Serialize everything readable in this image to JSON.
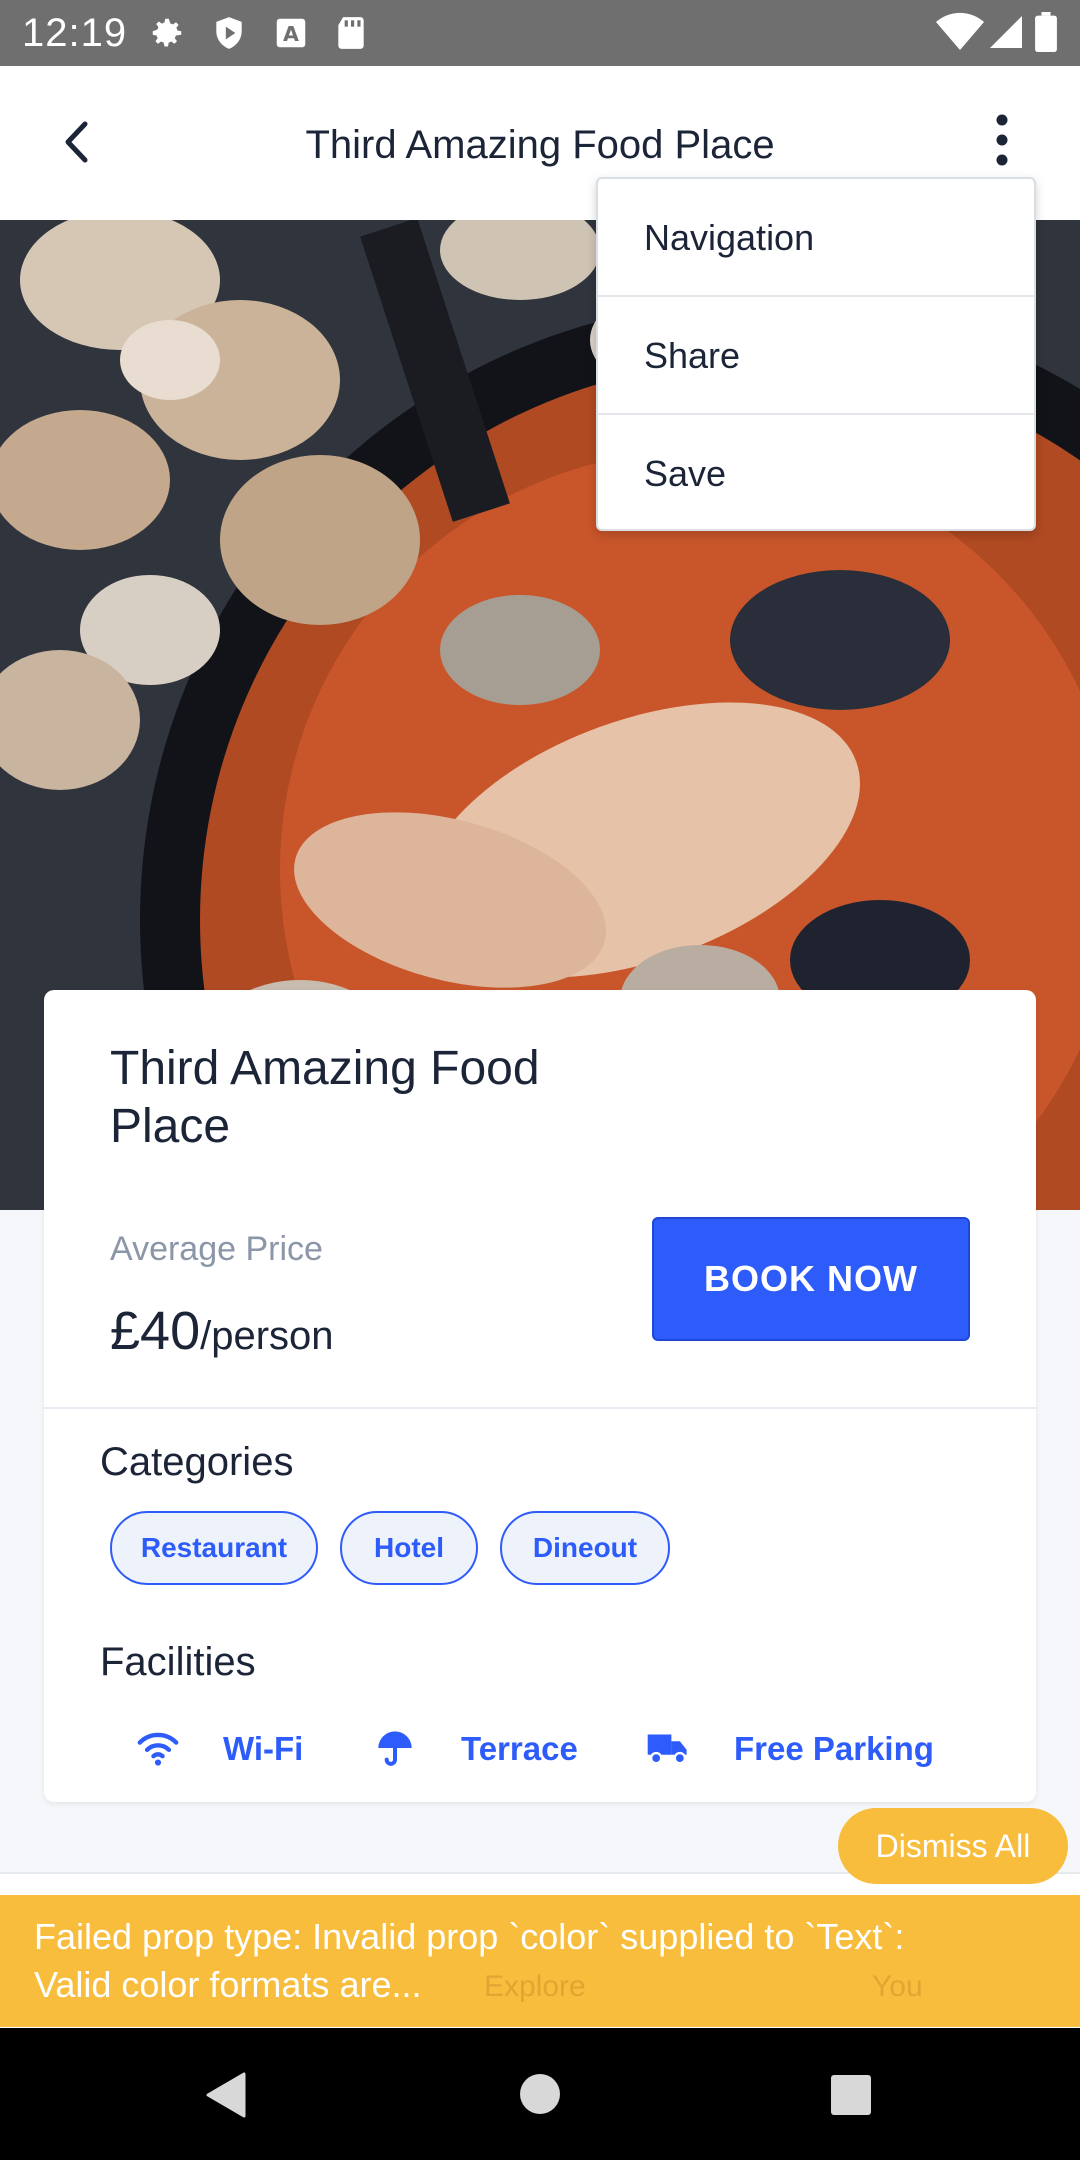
{
  "status_bar": {
    "time": "12:19",
    "icons": [
      "gear-icon",
      "shield-icon",
      "font-a-icon",
      "sd-card-icon",
      "wifi-icon",
      "signal-icon",
      "battery-icon"
    ]
  },
  "app_bar": {
    "title": "Third Amazing Food Place",
    "back_icon": "chevron-left-icon",
    "more_icon": "more-vertical-icon"
  },
  "menu": {
    "items": [
      {
        "label": "Navigation"
      },
      {
        "label": "Share"
      },
      {
        "label": "Save"
      }
    ]
  },
  "place": {
    "title": "Third Amazing Food Place",
    "avg_price_label": "Average Price",
    "price_amount": "£40",
    "price_unit": "/person",
    "book_label": "BOOK NOW"
  },
  "categories": {
    "title": "Categories",
    "items": [
      "Restaurant",
      "Hotel",
      "Dineout"
    ]
  },
  "facilities": {
    "title": "Facilities",
    "items": [
      {
        "label": "Wi-Fi",
        "icon": "wifi-icon"
      },
      {
        "label": "Terrace",
        "icon": "umbrella-icon"
      },
      {
        "label": "Free Parking",
        "icon": "truck-icon"
      }
    ]
  },
  "tab_bar": {
    "tabs": [
      "Explore",
      "You"
    ]
  },
  "toast": {
    "dismiss_label": "Dismiss All",
    "message_line1": "Failed prop type: Invalid prop `color` supplied to `Text`:",
    "message_line2": "Valid color formats are..."
  },
  "colors": {
    "accent": "#2d5cfa",
    "toast": "#f8bd3d",
    "text_dark": "#1c2438",
    "text_muted": "#8b96a8"
  }
}
